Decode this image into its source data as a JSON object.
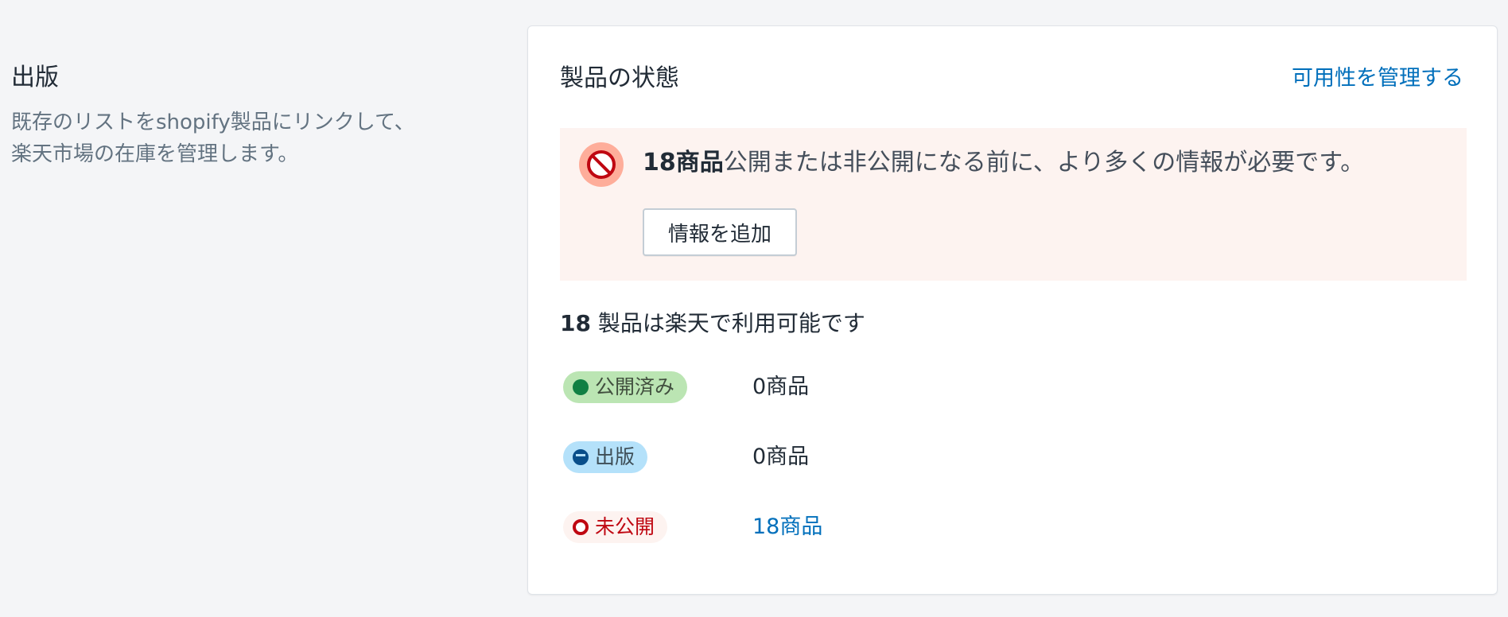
{
  "section": {
    "title": "出版",
    "description_line1": "既存のリストをshopify製品にリンクして、",
    "description_line2": "楽天市場の在庫を管理します。"
  },
  "card": {
    "title": "製品の状態",
    "manage_link": "可用性を管理する",
    "banner": {
      "icon": "prohibited-icon",
      "count_label": "18商品",
      "message": "公開または非公開になる前に、より多くの情報が必要です。",
      "button_label": "情報を追加"
    },
    "availability": {
      "count": "18",
      "text": " 製品は楽天で利用可能です"
    },
    "statuses": [
      {
        "badge": "公開済み",
        "value": "0商品"
      },
      {
        "badge": "出版",
        "value": "0商品"
      },
      {
        "badge": "未公開",
        "value": "18商品"
      }
    ]
  },
  "colors": {
    "link": "#006fbb",
    "banner_bg": "#fdf3f0",
    "published": "#108043",
    "publishing": "#084e8a",
    "unpublished": "#bf0711"
  }
}
